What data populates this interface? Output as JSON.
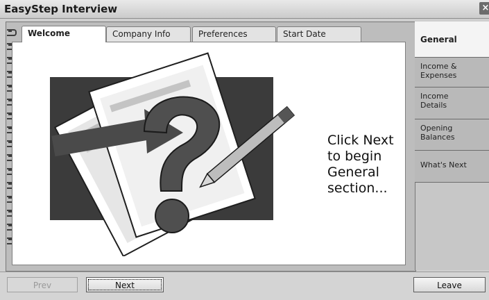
{
  "window": {
    "title": "EasyStep Interview",
    "close_icon": "close-icon"
  },
  "tabs": [
    {
      "label": "Welcome",
      "active": true
    },
    {
      "label": "Company Info",
      "active": false
    },
    {
      "label": "Preferences",
      "active": false
    },
    {
      "label": "Start Date",
      "active": false
    }
  ],
  "content": {
    "hint": "Click Next\nto begin\nGeneral\nsection...",
    "illustration": "question-mark-with-pencil"
  },
  "side_tabs": [
    {
      "label": "General",
      "active": true
    },
    {
      "label": "Income &\nExpenses"
    },
    {
      "label": "Income\nDetails"
    },
    {
      "label": "Opening\nBalances"
    },
    {
      "label": "What's Next"
    }
  ],
  "buttons": {
    "prev": "Prev",
    "next": "Next",
    "leave": "Leave"
  }
}
